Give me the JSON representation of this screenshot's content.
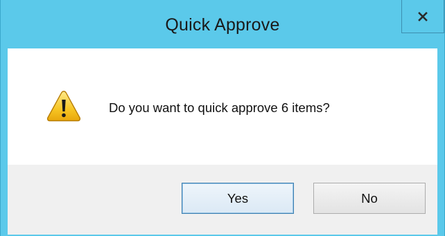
{
  "dialog": {
    "title": "Quick Approve",
    "close_label": "x",
    "message": "Do you want to quick approve 6 items?",
    "icon": "warning-icon",
    "buttons": {
      "yes": "Yes",
      "no": "No"
    }
  },
  "colors": {
    "titlebar": "#5bc9ea",
    "button_area": "#f0f0f0",
    "default_button_border": "#3c7fb1"
  }
}
